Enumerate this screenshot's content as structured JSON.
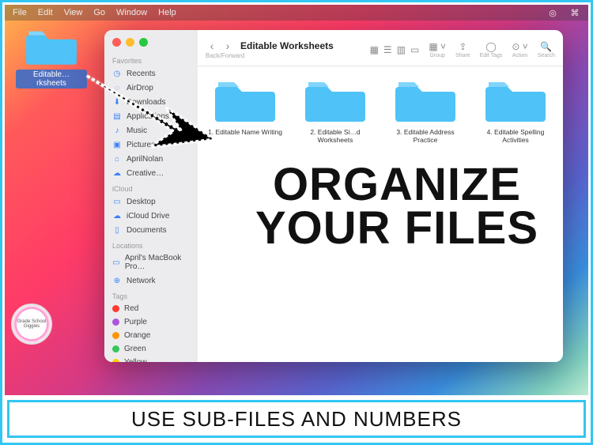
{
  "menubar": {
    "items": [
      "File",
      "Edit",
      "View",
      "Go",
      "Window",
      "Help"
    ]
  },
  "desktop_icon": {
    "label": "Editable…rksheets"
  },
  "finder": {
    "title": "Editable Worksheets",
    "subtitle": "Back/Forward",
    "toolbar": {
      "group_label": "Group",
      "share_label": "Share",
      "edit_tags_label": "Edit Tags",
      "action_label": "Action",
      "search_label": "Search"
    },
    "sidebar": {
      "sections": [
        {
          "title": "Favorites",
          "items": [
            {
              "icon": "clock-icon",
              "label": "Recents"
            },
            {
              "icon": "airdrop-icon",
              "label": "AirDrop"
            },
            {
              "icon": "download-icon",
              "label": "Downloads"
            },
            {
              "icon": "app-icon",
              "label": "Applications"
            },
            {
              "icon": "music-icon",
              "label": "Music"
            },
            {
              "icon": "picture-icon",
              "label": "Pictures"
            },
            {
              "icon": "home-icon",
              "label": "AprilNolan"
            },
            {
              "icon": "cloud-icon",
              "label": "Creative…"
            }
          ]
        },
        {
          "title": "iCloud",
          "items": [
            {
              "icon": "desktop-icon",
              "label": "Desktop"
            },
            {
              "icon": "cloud-icon",
              "label": "iCloud Drive"
            },
            {
              "icon": "doc-icon",
              "label": "Documents"
            }
          ]
        },
        {
          "title": "Locations",
          "items": [
            {
              "icon": "laptop-icon",
              "label": "April's MacBook Pro…"
            },
            {
              "icon": "globe-icon",
              "label": "Network"
            }
          ]
        },
        {
          "title": "Tags",
          "items": [
            {
              "color": "#ff3b30",
              "label": "Red"
            },
            {
              "color": "#af52de",
              "label": "Purple"
            },
            {
              "color": "#ff9500",
              "label": "Orange"
            },
            {
              "color": "#34c759",
              "label": "Green"
            },
            {
              "color": "#ffcc00",
              "label": "Yellow"
            }
          ]
        }
      ]
    },
    "folders": [
      {
        "label": "1. Editable Name Writing"
      },
      {
        "label": "2. Editable Si…d Worksheets"
      },
      {
        "label": "3. Editable Address Practice"
      },
      {
        "label": "4. Editable Spelling Activities"
      }
    ]
  },
  "overlay": {
    "line1": "ORGANIZE",
    "line2": "YOUR FILES"
  },
  "caption": "USE SUB-FILES AND NUMBERS",
  "badge": "Grade School Giggles"
}
